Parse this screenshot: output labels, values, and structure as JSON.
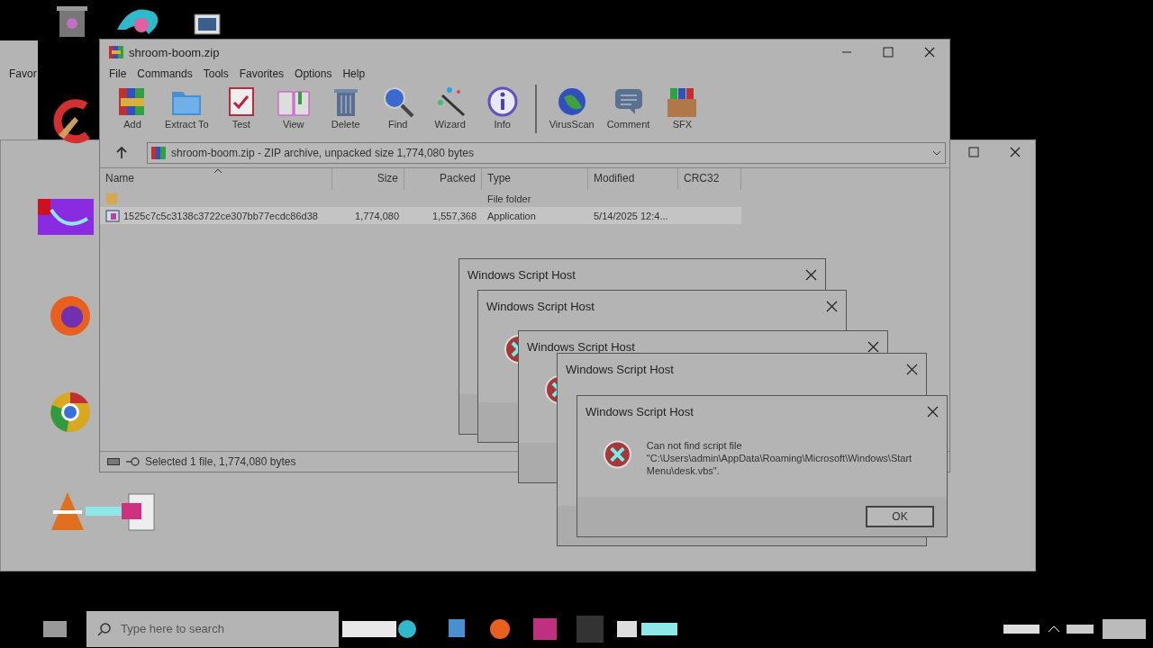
{
  "back_window": {
    "menu_fragment": "Favor"
  },
  "archive_window": {
    "title": "shroom-boom.zip",
    "menu": [
      "File",
      "Commands",
      "Tools",
      "Favorites",
      "Options",
      "Help"
    ],
    "toolbar": [
      [
        {
          "label": "Add",
          "kind": "add"
        },
        {
          "label": "Extract To",
          "kind": "extract"
        },
        {
          "label": "Test",
          "kind": "test"
        },
        {
          "label": "View",
          "kind": "view"
        },
        {
          "label": "Delete",
          "kind": "delete"
        },
        {
          "label": "Find",
          "kind": "find"
        },
        {
          "label": "Wizard",
          "kind": "wizard"
        },
        {
          "label": "Info",
          "kind": "info"
        }
      ],
      [
        {
          "label": "VirusScan",
          "kind": "virusscan"
        },
        {
          "label": "Comment",
          "kind": "comment"
        },
        {
          "label": "SFX",
          "kind": "sfx"
        }
      ]
    ],
    "path": "shroom-boom.zip - ZIP archive, unpacked size 1,774,080 bytes",
    "columns": [
      "Name",
      "Size",
      "Packed",
      "Type",
      "Modified",
      "CRC32"
    ],
    "rows": [
      {
        "kind": "folder",
        "selected": false,
        "cells": [
          "",
          "",
          "",
          "File folder",
          "",
          ""
        ]
      },
      {
        "kind": "file",
        "selected": true,
        "cells": [
          "1525c7c5c3138c3722ce307bb77ecdc86d38",
          "1,774,080",
          "1,557,368",
          "Application",
          "5/14/2025 12:4...",
          ""
        ]
      }
    ],
    "status": "Selected 1 file, 1,774,080 bytes"
  },
  "dialogs": [
    {
      "title": "Windows Script Host"
    },
    {
      "title": "Windows Script Host"
    },
    {
      "title": "Windows Script Host"
    },
    {
      "title": "Windows Script Host"
    },
    {
      "title": "Windows Script Host",
      "message": "Can not find script file \"C:\\Users\\admin\\AppData\\Roaming\\Microsoft\\Windows\\Start Menu\\desk.vbs\".",
      "button": "OK"
    }
  ],
  "taskbar": {
    "search": {
      "placeholder": "Type here to search"
    }
  }
}
